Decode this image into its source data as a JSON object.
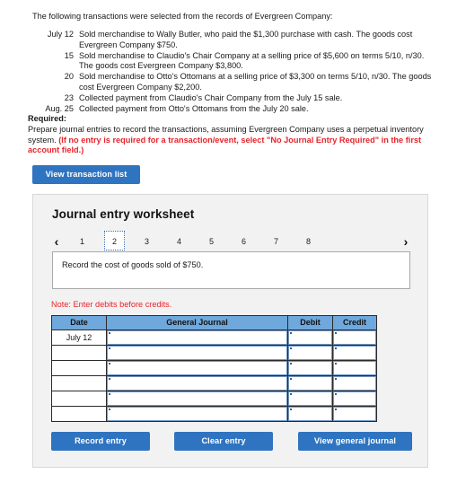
{
  "intro": {
    "text": "The following transactions were selected from the records of Evergreen Company:"
  },
  "transactions": [
    {
      "date": "July 12",
      "description": "Sold merchandise to Wally Butler, who paid the $1,300 purchase with cash. The goods cost Evergreen Company $750."
    },
    {
      "date": "15",
      "description": "Sold merchandise to Claudio's Chair Company at a selling price of $5,600 on terms 5/10, n/30. The goods cost Evergreen Company $3,800."
    },
    {
      "date": "20",
      "description": "Sold merchandise to Otto's Ottomans at a selling price of $3,300 on terms 5/10, n/30. The goods cost Evergreen Company $2,200."
    },
    {
      "date": "23",
      "description": "Collected payment from Claudio's Chair Company from the July 15 sale."
    },
    {
      "date": "Aug. 25",
      "description": "Collected payment from Otto's Ottomans from the July 20 sale."
    }
  ],
  "required": {
    "label": "Required:",
    "text": "Prepare journal entries to record the transactions, assuming Evergreen Company uses a perpetual inventory system. ",
    "red_text": "(If no entry is required for a transaction/event, select \"No Journal Entry Required\" in the first account field.)"
  },
  "buttons": {
    "view_transaction_list": "View transaction list",
    "record_entry": "Record entry",
    "clear_entry": "Clear entry",
    "view_general_journal": "View general journal"
  },
  "worksheet": {
    "title": "Journal entry worksheet",
    "pager": {
      "prev_icon": "‹",
      "next_icon": "›",
      "pages": [
        "1",
        "2",
        "3",
        "4",
        "5",
        "6",
        "7",
        "8"
      ],
      "active_page": "2"
    },
    "prompt": "Record the cost of goods sold of $750.",
    "note": "Note: Enter debits before credits.",
    "table": {
      "headers": [
        "Date",
        "General Journal",
        "Debit",
        "Credit"
      ],
      "rows": [
        {
          "date": "July 12",
          "general_journal": "",
          "debit": "",
          "credit": ""
        },
        {
          "date": "",
          "general_journal": "",
          "debit": "",
          "credit": ""
        },
        {
          "date": "",
          "general_journal": "",
          "debit": "",
          "credit": ""
        },
        {
          "date": "",
          "general_journal": "",
          "debit": "",
          "credit": ""
        },
        {
          "date": "",
          "general_journal": "",
          "debit": "",
          "credit": ""
        },
        {
          "date": "",
          "general_journal": "",
          "debit": "",
          "credit": ""
        }
      ]
    }
  },
  "colors": {
    "button_blue": "#2f74c0",
    "table_header_blue": "#6fa8dc",
    "alert_red": "#e8232a",
    "panel_bg": "#f2f2f2"
  }
}
